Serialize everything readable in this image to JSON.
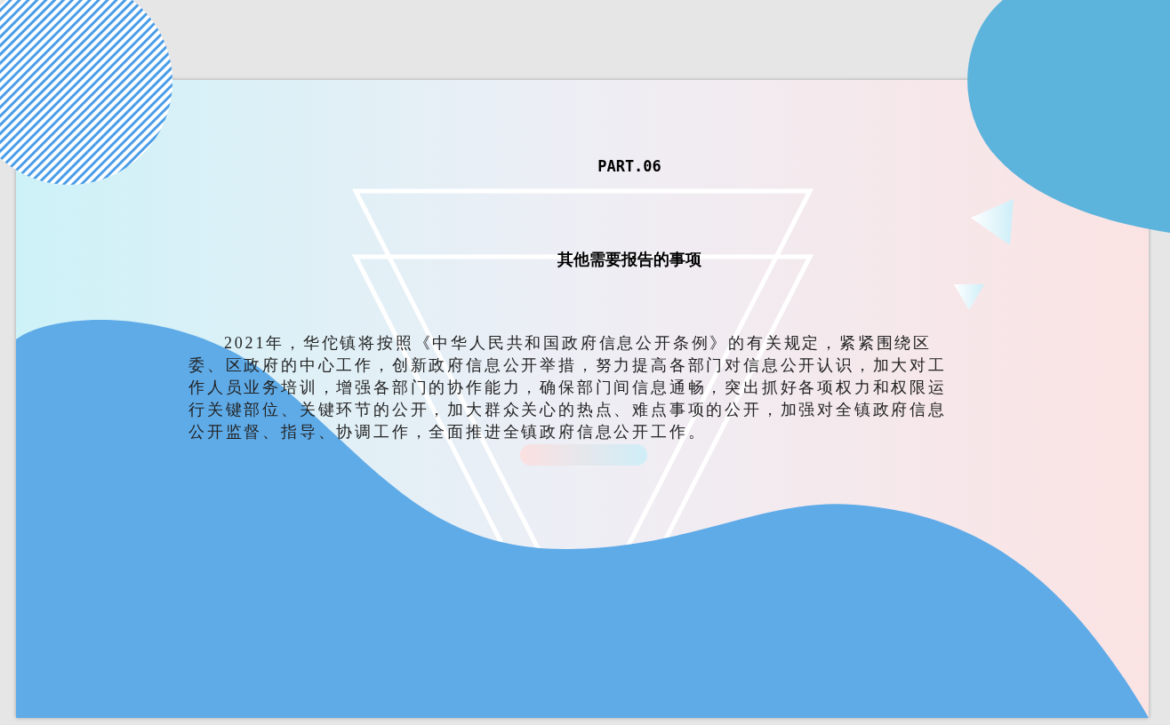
{
  "slide": {
    "part_label": "PART.06",
    "title": "其他需要报告的事项",
    "body": "2021年，华佗镇将按照《中华人民共和国政府信息公开条例》的有关规定，紧紧围绕区委、区政府的中心工作，创新政府信息公开举措，努力提高各部门对信息公开认识，加大对工作人员业务培训，增强各部门的协作能力，确保部门间信息通畅，突出抓好各项权力和权限运行关键部位、关键环节的公开，加大群众关心的热点、难点事项的公开，加强对全镇政府信息公开监督、指导、协调工作，全面推进全镇政府信息公开工作。"
  }
}
